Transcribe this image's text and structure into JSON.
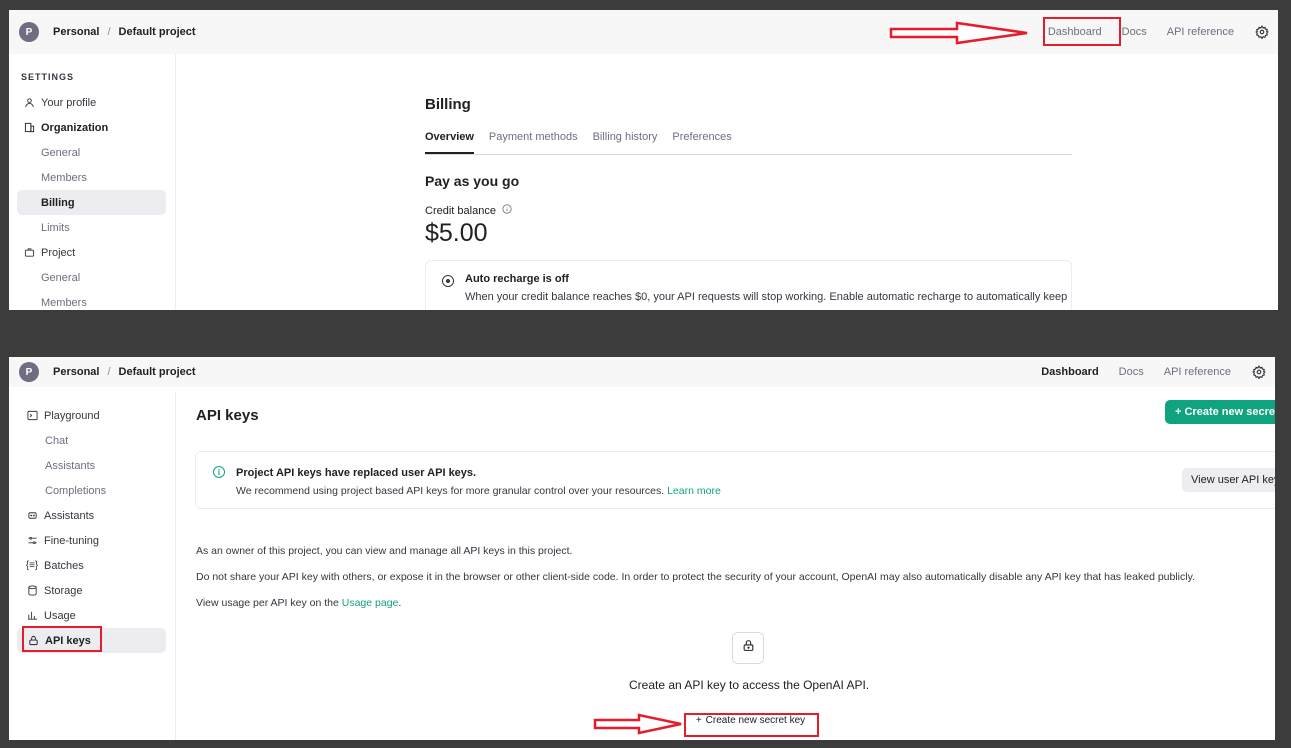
{
  "top_panel": {
    "header": {
      "avatar_letter": "P",
      "org": "Personal",
      "separator": "/",
      "project": "Default project",
      "nav": [
        "Dashboard",
        "Docs",
        "API reference"
      ]
    },
    "sidebar": {
      "heading": "SETTINGS",
      "items": [
        {
          "label": "Your profile"
        },
        {
          "label": "Organization"
        },
        {
          "label": "General"
        },
        {
          "label": "Members"
        },
        {
          "label": "Billing"
        },
        {
          "label": "Limits"
        },
        {
          "label": "Project"
        },
        {
          "label": "General"
        },
        {
          "label": "Members"
        }
      ]
    },
    "billing": {
      "title": "Billing",
      "tabs": [
        "Overview",
        "Payment methods",
        "Billing history",
        "Preferences"
      ],
      "plan": "Pay as you go",
      "credit_label": "Credit balance",
      "credit_value": "$5.00",
      "recharge_title": "Auto recharge is off",
      "recharge_text": "When your credit balance reaches $0, your API requests will stop working. Enable automatic recharge to automatically keep"
    }
  },
  "bottom_panel": {
    "header": {
      "avatar_letter": "P",
      "org": "Personal",
      "separator": "/",
      "project": "Default project",
      "nav": [
        "Dashboard",
        "Docs",
        "API reference"
      ]
    },
    "sidebar": {
      "items": [
        {
          "label": "Playground"
        },
        {
          "label": "Chat"
        },
        {
          "label": "Assistants"
        },
        {
          "label": "Completions"
        },
        {
          "label": "Assistants"
        },
        {
          "label": "Fine-tuning"
        },
        {
          "label": "Batches"
        },
        {
          "label": "Storage"
        },
        {
          "label": "Usage"
        },
        {
          "label": "API keys"
        }
      ]
    },
    "main": {
      "title": "API keys",
      "create_button": "+ Create new secret",
      "notice_title": "Project API keys have replaced user API keys.",
      "notice_text": "We recommend using project based API keys for more granular control over your resources.",
      "notice_link": "Learn more",
      "view_user_button": "View user API keys",
      "para1": "As an owner of this project, you can view and manage all API keys in this project.",
      "para2": "Do not share your API key with others, or expose it in the browser or other client-side code. In order to protect the security of your account, OpenAI may also automatically disable any API key that has leaked publicly.",
      "para3_prefix": "View usage per API key on the",
      "para3_link": "Usage page",
      "para3_suffix": ".",
      "empty_title": "Create an API key to access the OpenAI API.",
      "create_center_button": "Create new secret key",
      "plus": "+"
    }
  },
  "colors": {
    "accent": "#10a37f",
    "annotation": "#e51d2a",
    "background": "#3c3c3c"
  }
}
